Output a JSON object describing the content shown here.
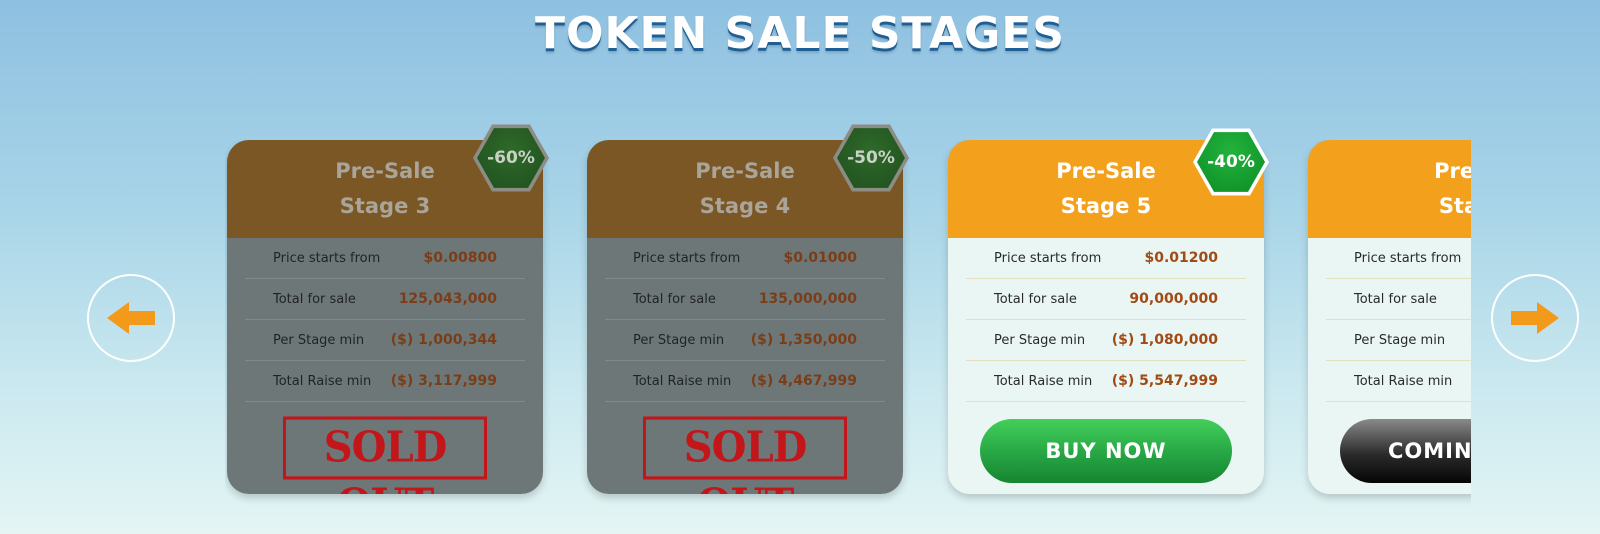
{
  "title": "TOKEN SALE STAGES",
  "colors": {
    "accent_orange": "#f3a11c",
    "sold_header": "#7a5725",
    "sold_body": "#6e7778",
    "value_text": "#a24a14",
    "buy_green": "#26a544",
    "title_shadow": "#1d5f96"
  },
  "nav": {
    "prev_icon": "arrow-left-icon",
    "next_icon": "arrow-right-icon"
  },
  "labels": {
    "price": "Price starts from",
    "total": "Total for sale",
    "per_min": "Per Stage min",
    "raise_min": "Total Raise min"
  },
  "cards": [
    {
      "heading": "Pre-Sale",
      "stage": "Stage 3",
      "discount": "-60%",
      "status": "sold",
      "price": "$0.00800",
      "total": "125,043,000",
      "per_min": "($) 1,000,344",
      "raise_min": "($) 3,117,999",
      "action": "SOLD OUT"
    },
    {
      "heading": "Pre-Sale",
      "stage": "Stage 4",
      "discount": "-50%",
      "status": "sold",
      "price": "$0.01000",
      "total": "135,000,000",
      "per_min": "($) 1,350,000",
      "raise_min": "($) 4,467,999",
      "action": "SOLD OUT"
    },
    {
      "heading": "Pre-Sale",
      "stage": "Stage 5",
      "discount": "-40%",
      "status": "active",
      "price": "$0.01200",
      "total": "90,000,000",
      "per_min": "($) 1,080,000",
      "raise_min": "($) 5,547,999",
      "action": "BUY NOW"
    },
    {
      "heading": "Pre-S",
      "stage": "Stag",
      "status": "upcoming",
      "action": "COMING"
    }
  ]
}
